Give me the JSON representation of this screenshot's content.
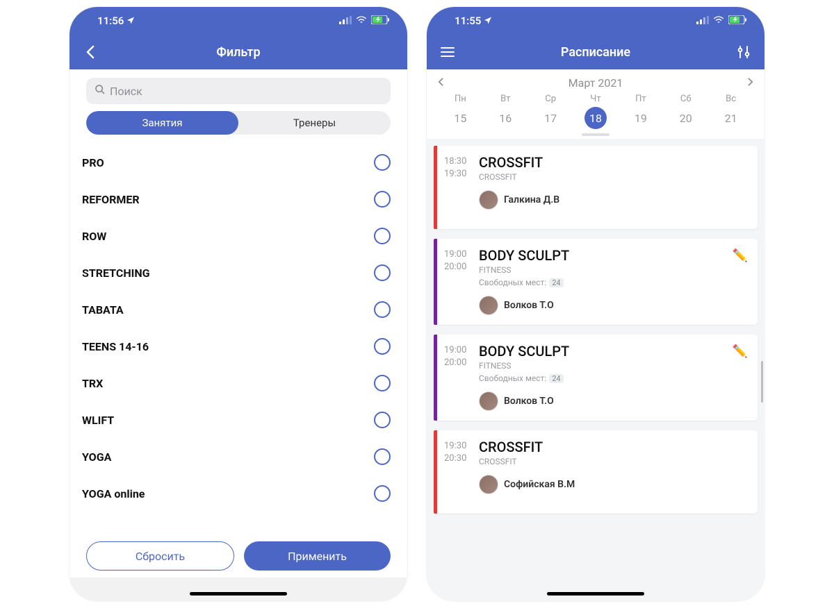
{
  "colors": {
    "primary": "#4c66c6"
  },
  "left": {
    "status": {
      "time": "11:56",
      "loc_icon": "location-arrow"
    },
    "nav": {
      "title": "Фильтр",
      "back_icon": "chevron-left"
    },
    "search": {
      "placeholder": "Поиск"
    },
    "segments": {
      "active": "Занятия",
      "inactive": "Тренеры"
    },
    "filters": [
      {
        "label": "PRO"
      },
      {
        "label": "REFORMER"
      },
      {
        "label": "ROW"
      },
      {
        "label": "STRETCHING"
      },
      {
        "label": "TABATA"
      },
      {
        "label": "TEENS 14-16"
      },
      {
        "label": "TRX"
      },
      {
        "label": "WLIFT"
      },
      {
        "label": "YOGA"
      },
      {
        "label": "YOGA online"
      }
    ],
    "actions": {
      "reset": "Сбросить",
      "apply": "Применить"
    }
  },
  "right": {
    "status": {
      "time": "11:55",
      "loc_icon": "location-arrow"
    },
    "nav": {
      "title": "Расписание",
      "menu_icon": "menu",
      "filter_icon": "sliders"
    },
    "calendar": {
      "month": "Март 2021",
      "days": [
        {
          "dow": "Пн",
          "num": "15",
          "selected": false
        },
        {
          "dow": "Вт",
          "num": "16",
          "selected": false
        },
        {
          "dow": "Ср",
          "num": "17",
          "selected": false
        },
        {
          "dow": "Чт",
          "num": "18",
          "selected": true
        },
        {
          "dow": "Пт",
          "num": "19",
          "selected": false
        },
        {
          "dow": "Сб",
          "num": "20",
          "selected": false
        },
        {
          "dow": "Вс",
          "num": "21",
          "selected": false
        }
      ]
    },
    "slots_label": "Свободных мест:",
    "classes": [
      {
        "start": "18:30",
        "end": "19:30",
        "title": "CROSSFIT",
        "subtitle": "CROSSFIT",
        "trainer": "Галкина Д.В",
        "color": "red",
        "editable": false,
        "slots": null
      },
      {
        "start": "19:00",
        "end": "20:00",
        "title": "BODY SCULPT",
        "subtitle": "FITNESS",
        "trainer": "Волков Т.О",
        "color": "purple",
        "editable": true,
        "slots": "24"
      },
      {
        "start": "19:00",
        "end": "20:00",
        "title": "BODY SCULPT",
        "subtitle": "FITNESS",
        "trainer": "Волков Т.О",
        "color": "purple",
        "editable": true,
        "slots": "24"
      },
      {
        "start": "19:30",
        "end": "20:30",
        "title": "CROSSFIT",
        "subtitle": "CROSSFIT",
        "trainer": "Софийская В.М",
        "color": "red",
        "editable": false,
        "slots": null
      }
    ]
  }
}
